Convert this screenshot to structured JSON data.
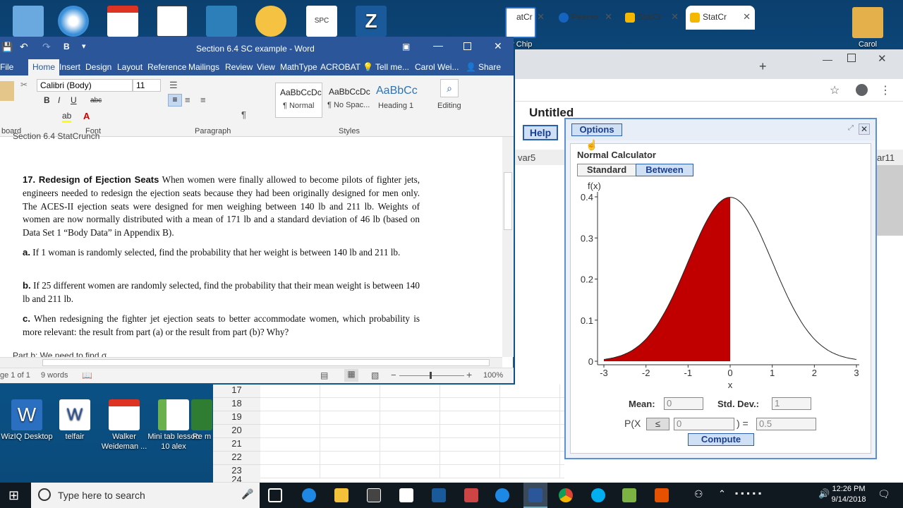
{
  "desktop": {
    "top_icons": [
      {
        "label": ""
      },
      {
        "label": ""
      },
      {
        "label": ""
      },
      {
        "label": ""
      },
      {
        "label": ""
      },
      {
        "label": "SPC"
      },
      {
        "label": ""
      },
      {
        "label": "P Chip"
      },
      {
        "label": "Carol"
      }
    ],
    "bottom_icons": [
      "WizIQ Desktop",
      "telfair",
      "Walker Weideman ...",
      "Mini tab lesson 10 alex",
      "Re m"
    ]
  },
  "chrome": {
    "tabs": [
      {
        "label": "atCr"
      },
      {
        "label": "Pearso"
      },
      {
        "label": "StatCr"
      },
      {
        "label": "StatCr"
      }
    ],
    "new_tab": "+"
  },
  "statcrunch": {
    "title": "Untitled",
    "help": "Help",
    "col_var5": "var5",
    "col_var11": "ar11",
    "rows": [
      "17",
      "18",
      "19",
      "20",
      "21",
      "22",
      "23",
      "24"
    ],
    "dialog": {
      "options": "Options",
      "calc_title": "Normal Calculator",
      "tab_standard": "Standard",
      "tab_between": "Between",
      "mean_label": "Mean:",
      "mean_value": "0",
      "sd_label": "Std. Dev.:",
      "sd_value": "1",
      "prob_prefix": "P(X",
      "operator": "≤",
      "x_value": "0",
      "prob_suffix": ") =",
      "result": "0.5",
      "compute": "Compute"
    }
  },
  "chart_data": {
    "type": "area",
    "title": "",
    "xlabel": "x",
    "ylabel": "f(x)",
    "xlim": [
      -3,
      3
    ],
    "ylim": [
      0,
      0.4
    ],
    "x_ticks": [
      -3,
      -2,
      -1,
      0,
      1,
      2,
      3
    ],
    "y_ticks": [
      0,
      0.1,
      0.2,
      0.3,
      0.4
    ],
    "distribution": "normal",
    "mean": 0,
    "sd": 1,
    "shaded_range": [
      -3,
      0
    ],
    "shade_color": "#c00000"
  },
  "word": {
    "title": "Section 6.4 SC example - Word",
    "tabs": [
      "File",
      "Home",
      "Insert",
      "Design",
      "Layout",
      "Reference",
      "Mailings",
      "Review",
      "View",
      "MathType",
      "ACROBAT"
    ],
    "tell_me": "Tell me...",
    "user": "Carol Wei...",
    "share": "Share",
    "font_name": "Calibri (Body)",
    "font_size": "11",
    "styles": [
      {
        "preview": "AaBbCcDc",
        "name": "¶ Normal"
      },
      {
        "preview": "AaBbCcDc",
        "name": "¶ No Spac..."
      },
      {
        "preview": "AaBbCc",
        "name": "Heading 1"
      }
    ],
    "editing": "Editing",
    "group_labels": [
      "board",
      "Font",
      "Paragraph",
      "Styles"
    ],
    "doc_header": "Section 6.4 StatCrunch",
    "problem_title": "17. Redesign of Ejection Seats",
    "problem_text": "When women were finally allowed to become pilots of fighter jets, engineers needed to redesign the ejection seats because they had been originally designed for men only. The ACES-II ejection seats were designed for men weighing between 140 lb and 211 lb. Weights of women are now normally distributed with a mean of 171 lb and a standard deviation of 46 lb (based on Data Set 1 “Body Data” in Appendix B).",
    "part_a_label": "a.",
    "part_a": "If 1 woman is randomly selected, find the probability that her weight is between 140 lb and 211 lb.",
    "part_b_label": "b.",
    "part_b": "If 25 different women are randomly selected, find the probability that their mean weight is between 140 lb and 211 lb.",
    "part_c_label": "c.",
    "part_c": "When redesigning the fighter jet ejection seats to better accommodate women, which probability is more relevant: the result from part (a) or the result from part (b)? Why?",
    "note": "Part b: We need to find σ",
    "page_status": "ge 1 of 1",
    "word_count": "9 words",
    "zoom": "100%"
  },
  "taskbar": {
    "search_placeholder": "Type here to search",
    "time": "12:26 PM",
    "date": "9/14/2018"
  }
}
